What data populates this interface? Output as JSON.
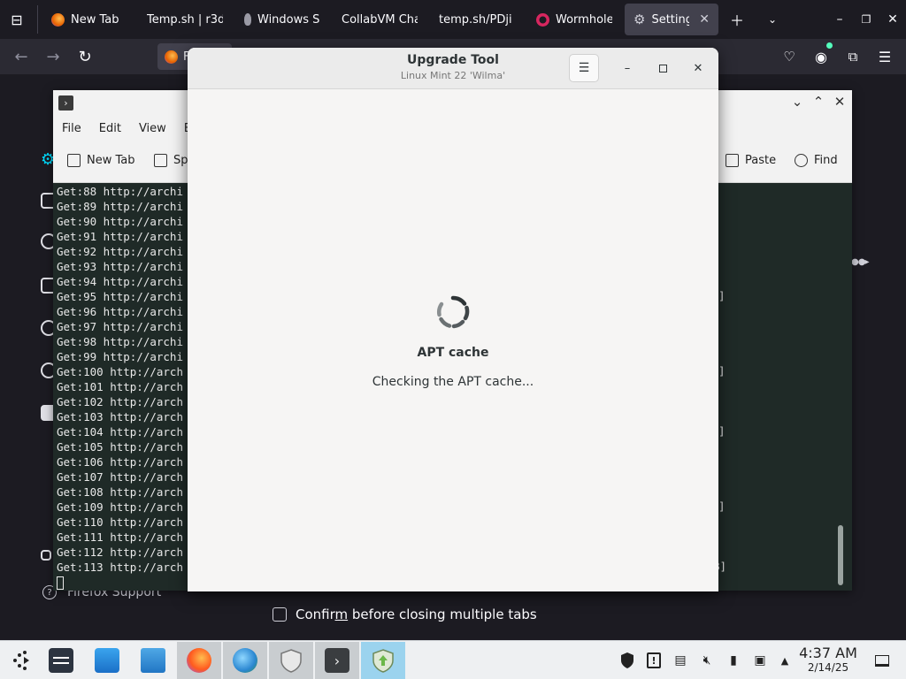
{
  "firefox": {
    "tabs": [
      {
        "label": "New Tab",
        "icon": "firefox-icon",
        "color": "#e66000"
      },
      {
        "label": "Temp.sh | r3d",
        "icon": "",
        "color": ""
      },
      {
        "label": "Windows S",
        "icon": "feather-icon",
        "color": "#9a9aa5"
      },
      {
        "label": "CollabVM Cha",
        "icon": "",
        "color": ""
      },
      {
        "label": "temp.sh/PDji",
        "icon": "",
        "color": ""
      },
      {
        "label": "Wormhole",
        "icon": "wormhole-icon",
        "color": "#d7265f"
      },
      {
        "label": "Settings",
        "icon": "gear-icon",
        "color": "#cfcfd8"
      }
    ],
    "url_stub": "F",
    "support_label": "Firefox Support",
    "confirm_label_pre": "Confir",
    "confirm_label_mnemonic": "m",
    "confirm_label_post": " before closing multiple tabs"
  },
  "terminal": {
    "menu": [
      "File",
      "Edit",
      "View",
      "B"
    ],
    "toolbar": {
      "new_tab": "New Tab",
      "split": "Sp",
      "paste": "Paste",
      "find": "Find"
    },
    "lines": [
      "Get:88 http://archi",
      "Get:89 http://archi",
      "Get:90 http://archi",
      "Get:91 http://archi",
      "Get:92 http://archi",
      "Get:93 http://archi",
      "Get:94 http://archi",
      "Get:95 http://archi",
      "Get:96 http://archi",
      "Get:97 http://archi",
      "Get:98 http://archi",
      "Get:99 http://archi",
      "Get:100 http://arch",
      "Get:101 http://arch",
      "Get:102 http://arch",
      "Get:103 http://arch",
      "Get:104 http://arch",
      "Get:105 http://arch",
      "Get:106 http://arch",
      "Get:107 http://arch",
      "Get:108 http://arch",
      "Get:109 http://arch",
      "Get:110 http://arch",
      "Get:111 http://arch",
      "Get:112 http://arch",
      "Get:113 http://arch"
    ],
    "last_line_suffix": "B]"
  },
  "dialog": {
    "title": "Upgrade Tool",
    "subtitle": "Linux Mint 22 'Wilma'",
    "status_title": "APT cache",
    "status_text": "Checking the APT cache..."
  },
  "taskbar": {
    "apps": [
      {
        "name": "menu-icon"
      },
      {
        "name": "settings-panel-icon"
      },
      {
        "name": "software-manager-icon"
      },
      {
        "name": "files-icon"
      },
      {
        "name": "firefox-icon"
      },
      {
        "name": "globe-icon"
      },
      {
        "name": "shield-icon"
      },
      {
        "name": "terminal-icon"
      },
      {
        "name": "update-manager-icon"
      }
    ],
    "time": "4:37 AM",
    "date": "2/14/25"
  }
}
